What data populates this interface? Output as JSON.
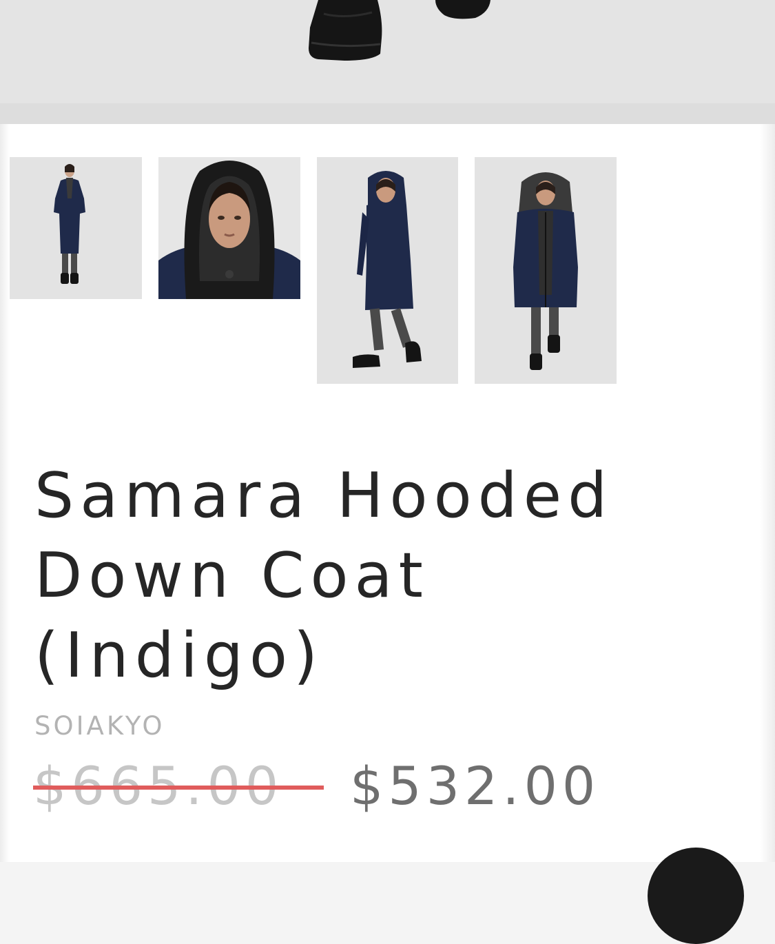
{
  "product": {
    "title": "Samara Hooded Down Coat (Indigo)",
    "brand": "SOIAKYO",
    "price_original": "$665.00",
    "price_sale": "$532.00"
  },
  "gallery": {
    "main_image": "product-main-image",
    "thumbnails": [
      "front-full-view",
      "hood-closeup",
      "side-walking-view",
      "front-open-view"
    ]
  },
  "colors": {
    "coat": "#1f2a4a",
    "strike": "#e05c5c",
    "title": "#262626",
    "brand": "#b3b3b3",
    "sale_price": "#6f6f6f"
  }
}
